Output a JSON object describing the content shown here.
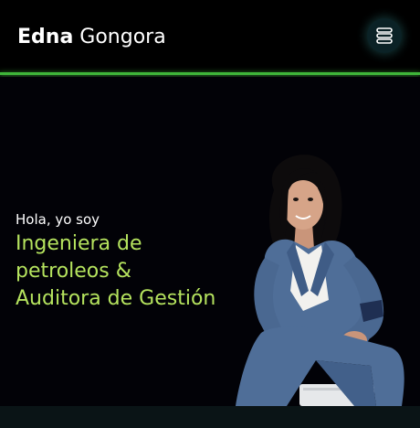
{
  "header": {
    "brand_first": "Edna",
    "brand_last": "Gongora",
    "menu_icon": "hamburger-menu-icon"
  },
  "hero": {
    "greeting": "Hola, yo soy",
    "role_lines": [
      "Ingeniera de",
      "petroleos &",
      "Auditora de Gestión"
    ]
  },
  "colors": {
    "accent_green": "#b5e35e",
    "nav_underline": "#3fb53a",
    "background": "#020207"
  }
}
